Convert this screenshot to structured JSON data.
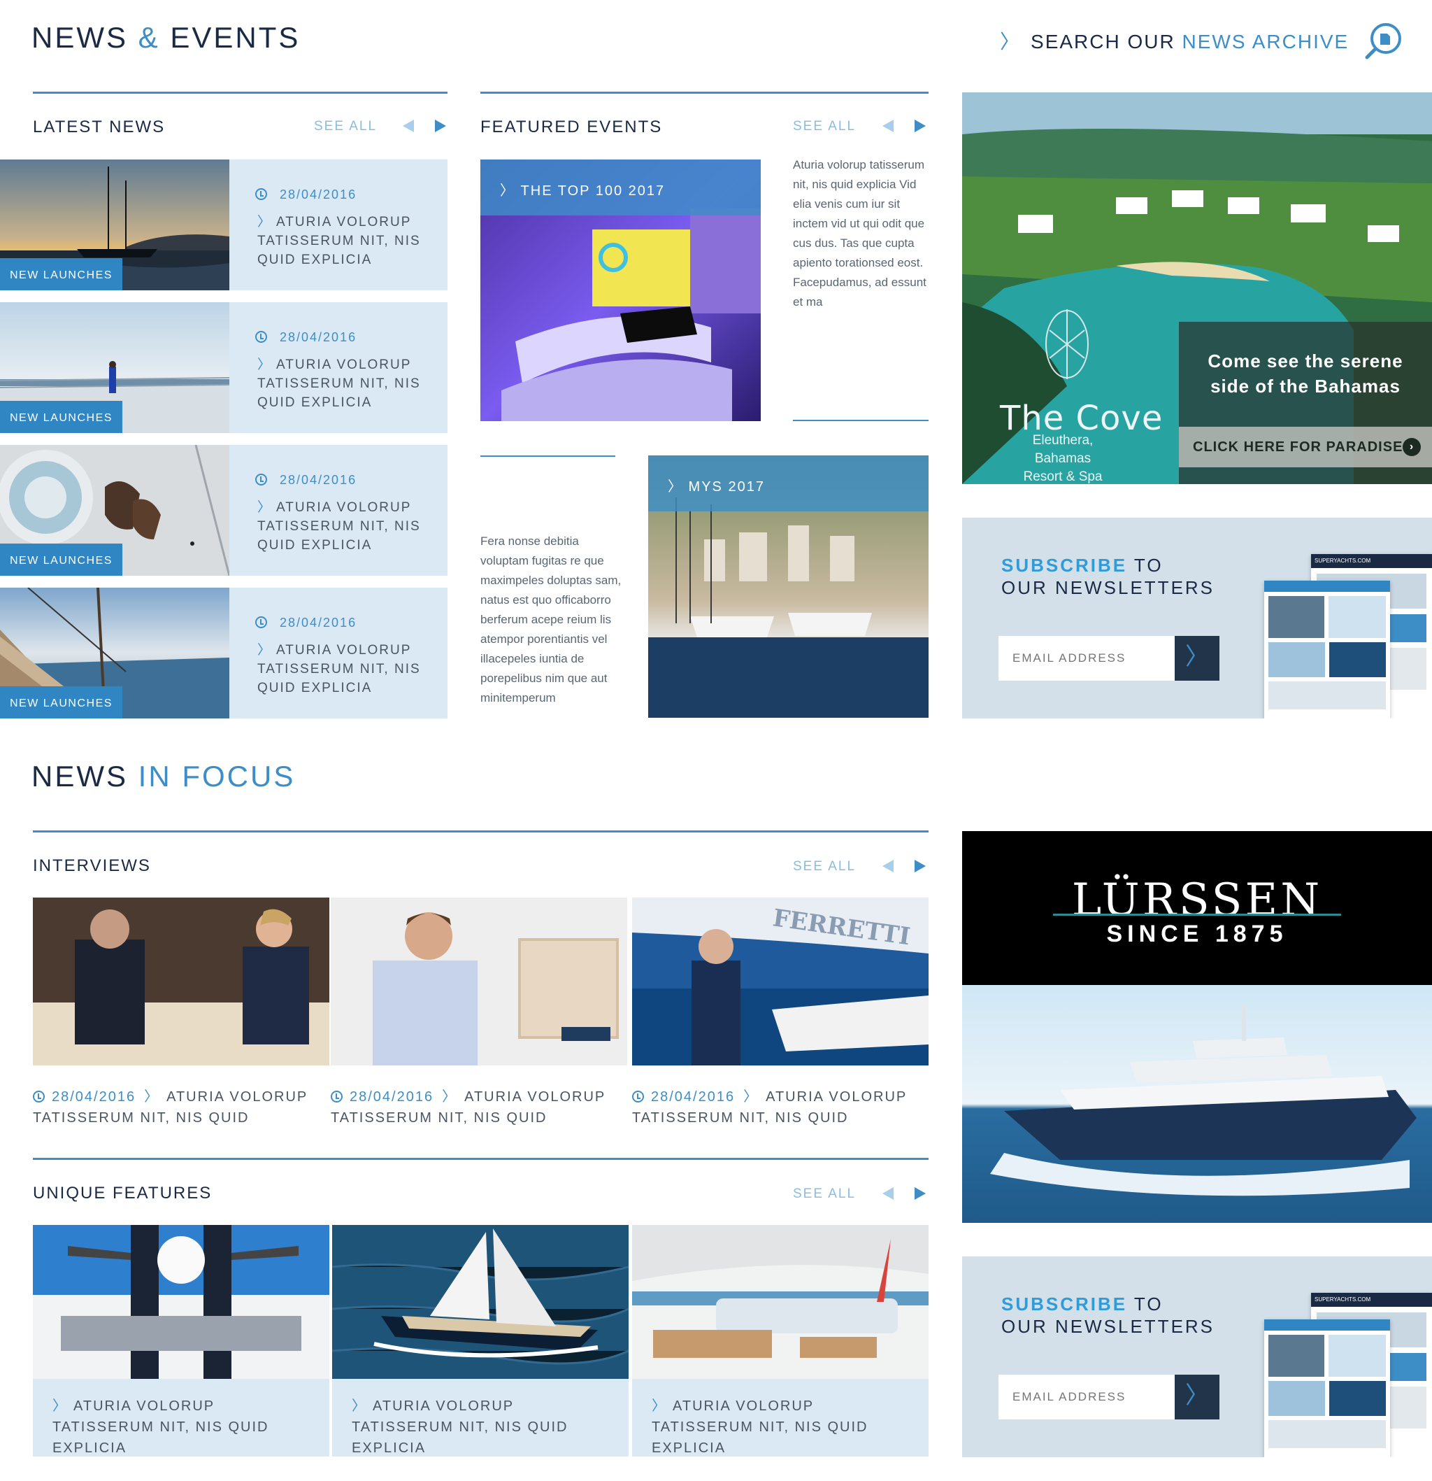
{
  "header": {
    "title_left": "NEWS",
    "title_amp": "&",
    "title_right": "EVENTS",
    "search_chevron": "〉",
    "search_text_a": "SEARCH OUR",
    "search_text_b": "NEWS ARCHIVE"
  },
  "latest_news": {
    "title": "LATEST NEWS",
    "see_all": "SEE ALL",
    "items": [
      {
        "badge": "NEW LAUNCHES",
        "date": "28/04/2016",
        "chevron": "〉",
        "text": "ATURIA VOLORUP TATISSERUM NIT, NIS QUID EXPLICIA"
      },
      {
        "badge": "NEW LAUNCHES",
        "date": "28/04/2016",
        "chevron": "〉",
        "text": "ATURIA VOLORUP TATISSERUM NIT, NIS QUID EXPLICIA"
      },
      {
        "badge": "NEW LAUNCHES",
        "date": "28/04/2016",
        "chevron": "〉",
        "text": "ATURIA VOLORUP TATISSERUM NIT, NIS QUID EXPLICIA"
      },
      {
        "badge": "NEW LAUNCHES",
        "date": "28/04/2016",
        "chevron": "〉",
        "text": "ATURIA VOLORUP TATISSERUM NIT, NIS QUID EXPLICIA"
      }
    ]
  },
  "featured_events": {
    "title": "FEATURED EVENTS",
    "see_all": "SEE ALL",
    "event1": {
      "label": "〉 THE TOP 100 2017",
      "text": "Aturia volorup tatisserum nit, nis quid explicia Vid elia venis cum iur sit inctem vid ut qui odit que cus dus. Tas que cupta apiento torationsed eost. Facepudamus, ad essunt et ma"
    },
    "event2": {
      "label": "〉 MYS 2017",
      "text": "Fera nonse debitia voluptam fugitas re que maximpeles doluptas sam, natus est quo officaborro berferum acepe reium lis atempor porentiantis vel illacepeles iuntia de porepelibus nim que aut minitemperum"
    }
  },
  "ad_cove": {
    "title": "The Cove",
    "sub1": "Eleuthera, Bahamas",
    "sub2": "Resort & Spa",
    "tagline1": "Come see the serene",
    "tagline2": "side of the Bahamas",
    "cta": "CLICK HERE FOR PARADISE",
    "cta_icon": "›"
  },
  "subscribe": {
    "highlight": "SUBSCRIBE",
    "to": "TO",
    "line2": "OUR NEWSLETTERS",
    "placeholder": "EMAIL ADDRESS",
    "button": "〉"
  },
  "news_in_focus": {
    "title_a": "NEWS",
    "title_b": "IN FOCUS"
  },
  "interviews": {
    "title": "INTERVIEWS",
    "see_all": "SEE ALL",
    "items": [
      {
        "date": "28/04/2016",
        "chevron": "〉",
        "text": "ATURIA VOLORUP",
        "text2": "TATISSERUM NIT, NIS QUID"
      },
      {
        "date": "28/04/2016",
        "chevron": "〉",
        "text": "ATURIA VOLORUP",
        "text2": "TATISSERUM NIT, NIS QUID"
      },
      {
        "date": "28/04/2016",
        "chevron": "〉",
        "text": "ATURIA VOLORUP",
        "text2": "TATISSERUM NIT, NIS QUID"
      }
    ]
  },
  "unique_features": {
    "title": "UNIQUE FEATURES",
    "see_all": "SEE ALL",
    "items": [
      {
        "chevron": "〉",
        "text": "ATURIA VOLORUP TATISSERUM NIT, NIS QUID EXPLICIA"
      },
      {
        "chevron": "〉",
        "text": "ATURIA VOLORUP TATISSERUM NIT, NIS QUID EXPLICIA"
      },
      {
        "chevron": "〉",
        "text": "ATURIA VOLORUP TATISSERUM NIT, NIS QUID EXPLICIA"
      }
    ]
  },
  "ad_lurssen": {
    "name": "LÜRSSEN",
    "since": "SINCE 1875"
  },
  "magazine": {
    "masthead": "SUPERYACHTS.COM"
  },
  "colors": {
    "accent": "#3d8dc7",
    "navy": "#1b2a44",
    "panel": "#dbe9f4",
    "subscribe_bg": "#d3e0ea"
  }
}
